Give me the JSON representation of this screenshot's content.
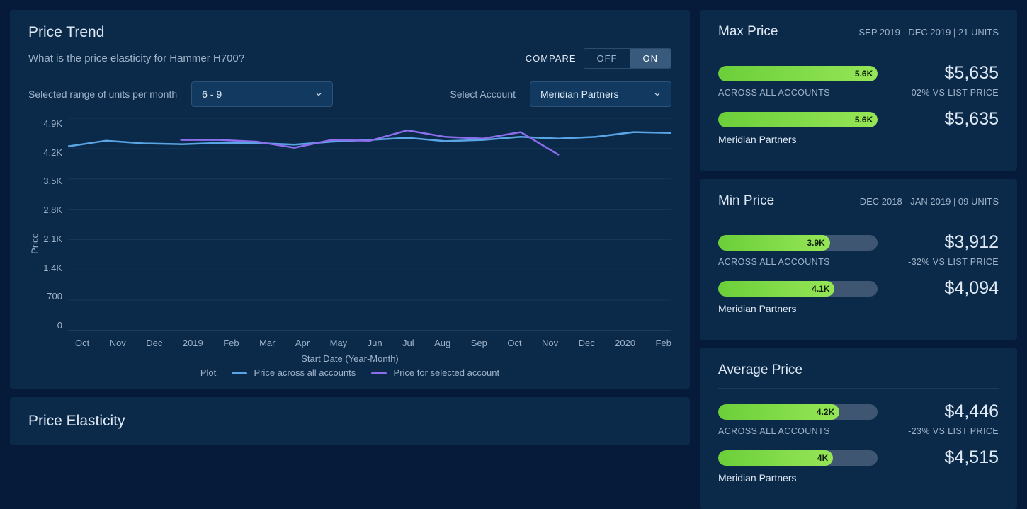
{
  "left": {
    "title": "Price Trend",
    "subtitle": "What is the price elasticity for Hammer H700?",
    "compare_label": "COMPARE",
    "toggle_off": "OFF",
    "toggle_on": "ON",
    "range_label": "Selected range of units per month",
    "range_value": "6 - 9",
    "account_label": "Select Account",
    "account_value": "Meridian Partners",
    "yaxis_label": "Price",
    "xaxis_label": "Start Date (Year-Month)",
    "legend_label": "Plot",
    "legend_all": "Price across all accounts",
    "legend_selected": "Price for selected account",
    "elasticity_title": "Price Elasticity"
  },
  "right": {
    "cards": [
      {
        "title": "Max Price",
        "meta": "SEP 2019 - DEC 2019   |   21 UNITS",
        "rows": [
          {
            "pill_label": "5.6K",
            "fill_pct": 100,
            "price": "$5,635",
            "caption": "ACROSS ALL ACCOUNTS",
            "delta": "-02% VS LIST PRICE"
          },
          {
            "pill_label": "5.6K",
            "fill_pct": 100,
            "price": "$5,635",
            "caption": "Meridian Partners",
            "delta": ""
          }
        ]
      },
      {
        "title": "Min Price",
        "meta": "DEC 2018 - JAN 2019   |   09 UNITS",
        "rows": [
          {
            "pill_label": "3.9K",
            "fill_pct": 70,
            "price": "$3,912",
            "caption": "ACROSS ALL ACCOUNTS",
            "delta": "-32% VS LIST PRICE"
          },
          {
            "pill_label": "4.1K",
            "fill_pct": 73,
            "price": "$4,094",
            "caption": "Meridian Partners",
            "delta": ""
          }
        ]
      },
      {
        "title": "Average Price",
        "meta": "",
        "rows": [
          {
            "pill_label": "4.2K",
            "fill_pct": 76,
            "price": "$4,446",
            "caption": "ACROSS ALL ACCOUNTS",
            "delta": "-23% VS LIST PRICE"
          },
          {
            "pill_label": "4K",
            "fill_pct": 72,
            "price": "$4,515",
            "caption": "Meridian Partners",
            "delta": ""
          }
        ]
      }
    ]
  },
  "chart_data": {
    "type": "line",
    "ylabel": "Price",
    "xlabel": "Start Date (Year-Month)",
    "ylim": [
      0,
      4900
    ],
    "yticks": [
      "4.9K",
      "4.2K",
      "3.5K",
      "2.8K",
      "2.1K",
      "1.4K",
      "700",
      "0"
    ],
    "categories": [
      "Oct",
      "Nov",
      "Dec",
      "2019",
      "Feb",
      "Mar",
      "Apr",
      "May",
      "Jun",
      "Jul",
      "Aug",
      "Sep",
      "Oct",
      "Nov",
      "Dec",
      "2020",
      "Feb"
    ],
    "series": [
      {
        "name": "Price across all accounts",
        "color": "#5aa5e6",
        "values": [
          4250,
          4380,
          4320,
          4300,
          4330,
          4330,
          4290,
          4360,
          4400,
          4450,
          4370,
          4400,
          4470,
          4430,
          4470,
          4580,
          4560
        ]
      },
      {
        "name": "Price for selected account",
        "color": "#8c6eed",
        "values": [
          null,
          null,
          null,
          4400,
          4400,
          4360,
          4220,
          4400,
          4380,
          4620,
          4470,
          4430,
          4580,
          4060,
          null,
          null,
          null
        ]
      }
    ]
  }
}
